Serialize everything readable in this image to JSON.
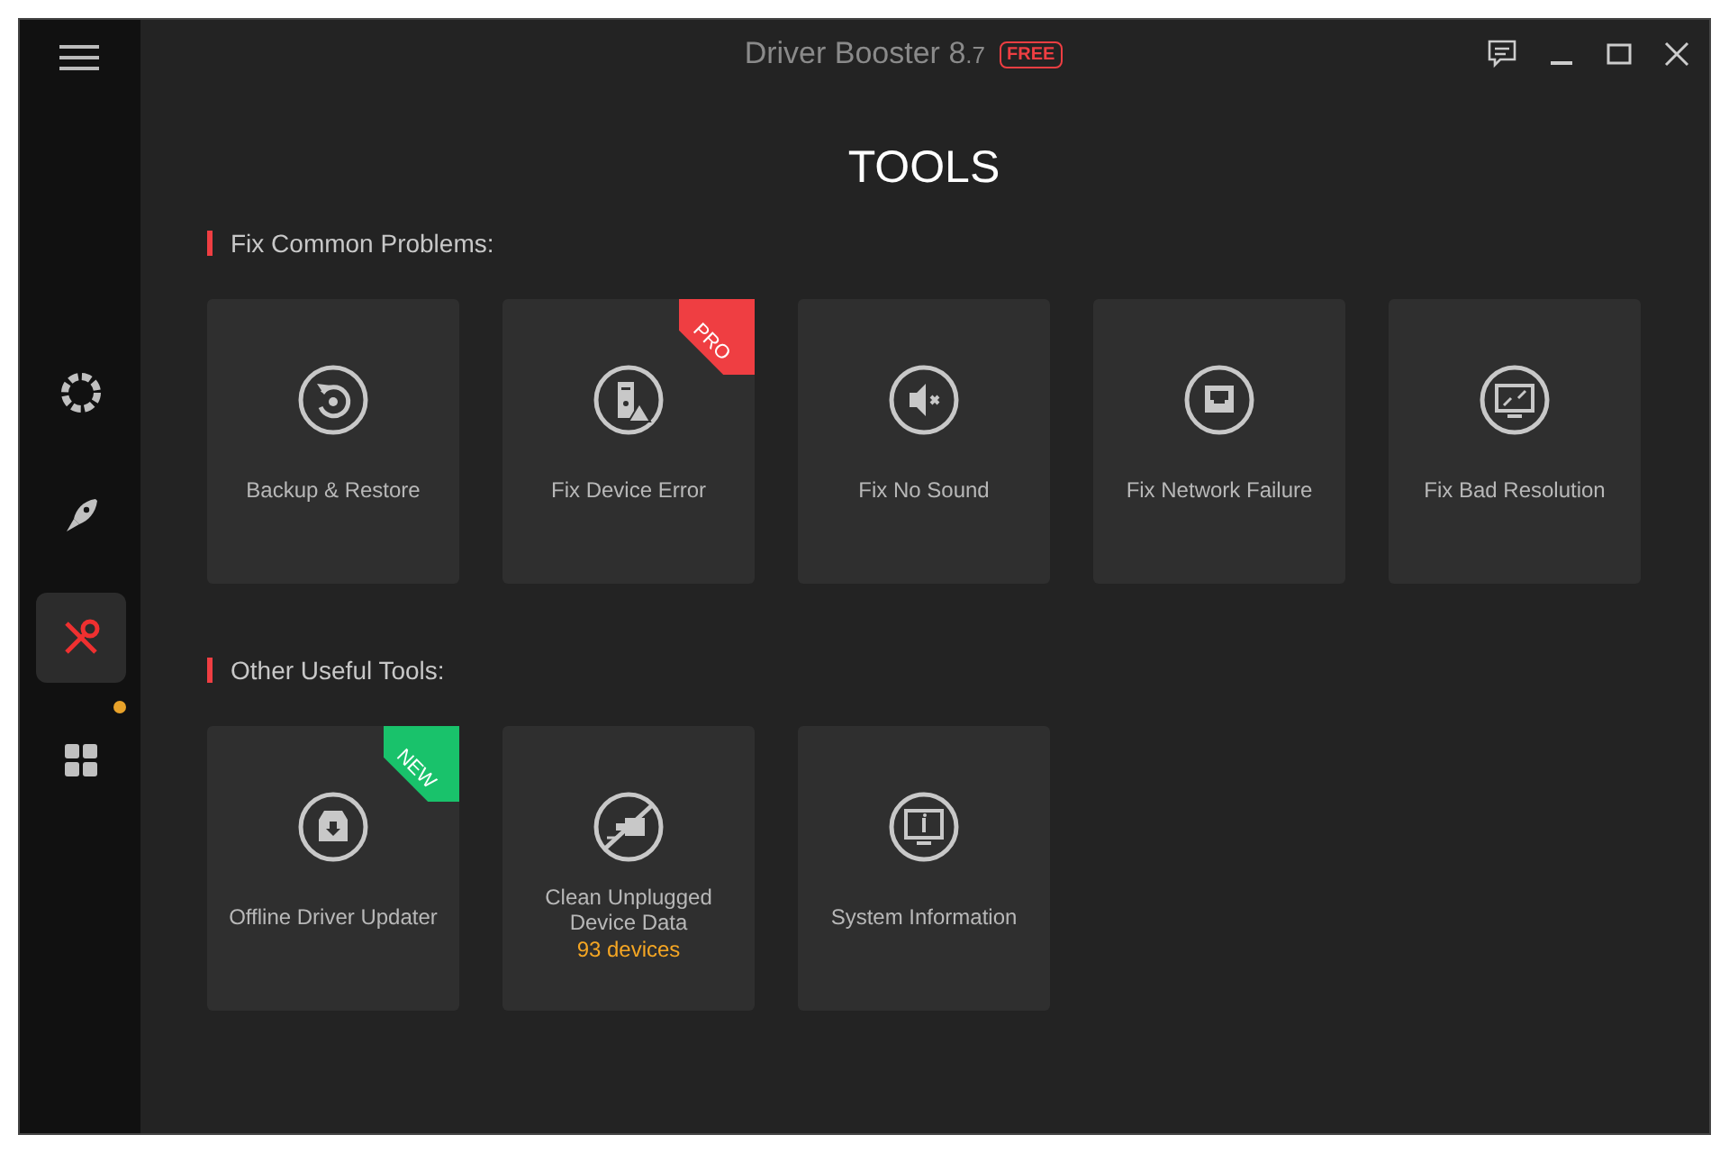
{
  "window": {
    "title": "Driver Booster 8",
    "version": ".7",
    "edition": "FREE"
  },
  "sidebar": {
    "items": [
      {
        "selected": false,
        "notification": false
      },
      {
        "selected": false,
        "notification": false
      },
      {
        "selected": true,
        "notification": false
      },
      {
        "selected": false,
        "notification": true
      }
    ]
  },
  "page_title": "TOOLS",
  "sections": [
    {
      "heading": "Fix Common Problems:",
      "tools": [
        {
          "label": "Backup & Restore"
        },
        {
          "label": "Fix Device Error",
          "badge": {
            "text": "PRO",
            "kind": "pro"
          }
        },
        {
          "label": "Fix No Sound"
        },
        {
          "label": "Fix Network Failure"
        },
        {
          "label": "Fix Bad Resolution"
        }
      ]
    },
    {
      "heading": "Other Useful Tools:",
      "tools": [
        {
          "label": "Offline Driver Updater",
          "badge": {
            "text": "NEW",
            "kind": "new"
          }
        },
        {
          "label": "Clean Unplugged Device Data",
          "count": "93 devices"
        },
        {
          "label": "System Information"
        }
      ]
    }
  ]
}
